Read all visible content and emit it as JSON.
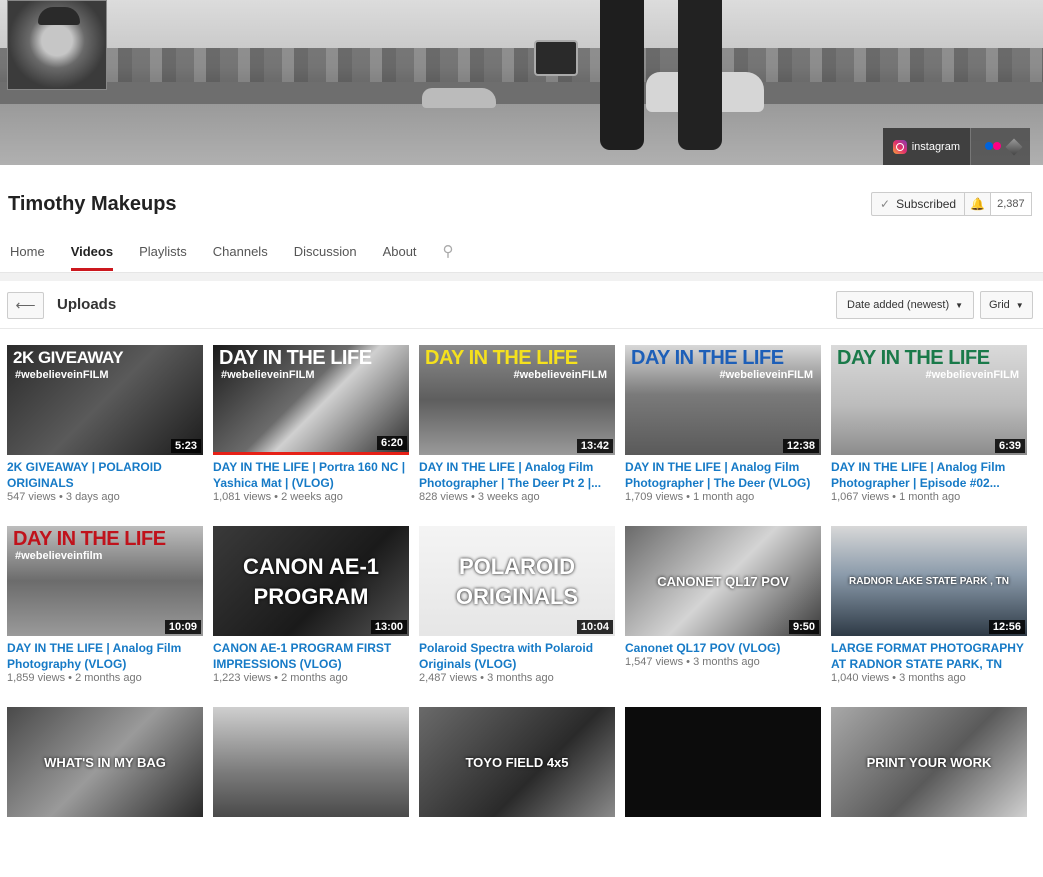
{
  "channel": {
    "name": "Timothy Makeups",
    "subscribe_label": "Subscribed",
    "subscriber_count": "2,387",
    "instagram_label": "instagram"
  },
  "tabs": [
    {
      "label": "Home",
      "active": false
    },
    {
      "label": "Videos",
      "active": true
    },
    {
      "label": "Playlists",
      "active": false
    },
    {
      "label": "Channels",
      "active": false
    },
    {
      "label": "Discussion",
      "active": false
    },
    {
      "label": "About",
      "active": false
    }
  ],
  "uploads": {
    "title": "Uploads",
    "sort_label": "Date added (newest)",
    "view_label": "Grid"
  },
  "videos": [
    {
      "title": "2K GIVEAWAY | POLAROID ORIGINALS",
      "views": "547 views",
      "age": "3 days ago",
      "duration": "5:23",
      "thumb_text": "2K GIVEAWAY",
      "thumb_tag": "#webelieveinFILM",
      "thumb_color": "#ffffff"
    },
    {
      "title": "DAY IN THE LIFE | Portra 160 NC | Yashica Mat | (VLOG)",
      "views": "1,081 views",
      "age": "2 weeks ago",
      "duration": "6:20",
      "thumb_text": "DAY IN THE LIFE",
      "thumb_tag": "#webelieveinFILM",
      "thumb_color": "#ffffff",
      "progress": 1.0
    },
    {
      "title": "DAY IN THE LIFE | Analog Film Photographer | The Deer Pt 2 |...",
      "views": "828 views",
      "age": "3 weeks ago",
      "duration": "13:42",
      "thumb_text": "DAY IN THE LIFE",
      "thumb_tag": "#webelieveinFILM",
      "thumb_color": "#f5e11d"
    },
    {
      "title": "DAY IN THE LIFE | Analog Film Photographer | The Deer (VLOG)",
      "views": "1,709 views",
      "age": "1 month ago",
      "duration": "12:38",
      "thumb_text": "DAY IN THE LIFE",
      "thumb_tag": "#webelieveinFILM",
      "thumb_color": "#1d5fb8"
    },
    {
      "title": "DAY IN THE LIFE | Analog Film Photographer | Episode #02...",
      "views": "1,067 views",
      "age": "1 month ago",
      "duration": "6:39",
      "thumb_text": "DAY IN THE LIFE",
      "thumb_tag": "#webelieveinFILM",
      "thumb_color": "#1a7a4a"
    },
    {
      "title": "DAY IN THE LIFE | Analog Film Photography (VLOG)",
      "views": "1,859 views",
      "age": "2 months ago",
      "duration": "10:09",
      "thumb_text": "DAY IN THE LIFE",
      "thumb_tag": "#webelieveinfilm",
      "thumb_color": "#c0121b"
    },
    {
      "title": "CANON AE-1 PROGRAM FIRST IMPRESSIONS (VLOG)",
      "views": "1,223 views",
      "age": "2 months ago",
      "duration": "13:00",
      "thumb_text": "CANON AE-1 PROGRAM",
      "thumb_color": "#ffffff"
    },
    {
      "title": "Polaroid Spectra with Polaroid Originals (VLOG)",
      "views": "2,487 views",
      "age": "3 months ago",
      "duration": "10:04",
      "thumb_text": "POLAROID ORIGINALS",
      "thumb_color": "#ffffff"
    },
    {
      "title": "Canonet QL17 POV (VLOG)",
      "views": "1,547 views",
      "age": "3 months ago",
      "duration": "9:50",
      "thumb_text": "CANONET QL17 POV",
      "thumb_color": "#ffffff"
    },
    {
      "title": "LARGE FORMAT PHOTOGRAPHY AT RADNOR STATE PARK, TN",
      "views": "1,040 views",
      "age": "3 months ago",
      "duration": "12:56",
      "thumb_text": "RADNOR LAKE STATE PARK , TN",
      "thumb_color": "#ffffff"
    },
    {
      "title": "",
      "views": "",
      "age": "",
      "duration": "",
      "thumb_text": "WHAT'S IN MY BAG",
      "thumb_color": "#ffffff"
    },
    {
      "title": "",
      "views": "",
      "age": "",
      "duration": "",
      "thumb_text": "",
      "thumb_color": "#ffffff"
    },
    {
      "title": "",
      "views": "",
      "age": "",
      "duration": "",
      "thumb_text": "TOYO FIELD 4x5",
      "thumb_color": "#ffffff"
    },
    {
      "title": "",
      "views": "",
      "age": "",
      "duration": "",
      "thumb_text": "",
      "thumb_color": "#ffffff"
    },
    {
      "title": "",
      "views": "",
      "age": "",
      "duration": "",
      "thumb_text": "PRINT YOUR WORK",
      "thumb_color": "#ffffff"
    }
  ]
}
